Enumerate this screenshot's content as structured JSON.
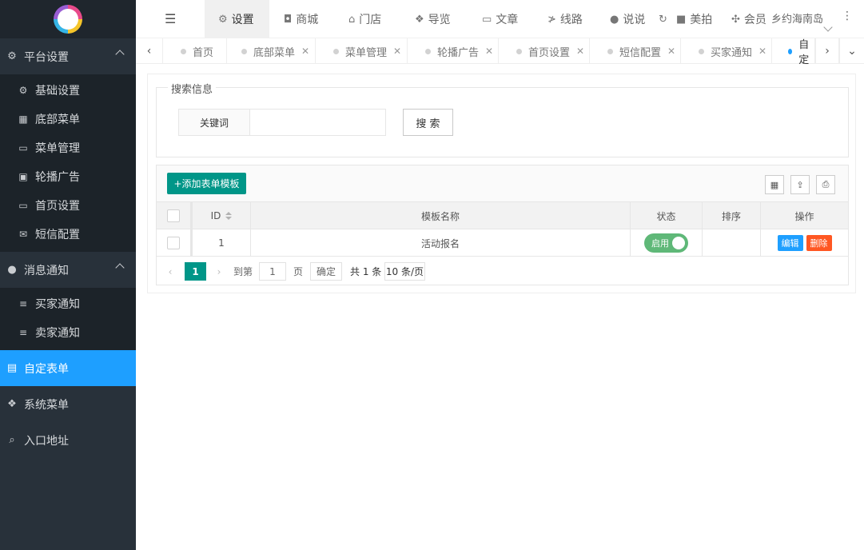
{
  "sidebar": {
    "groups": [
      {
        "label": "平台设置",
        "items": [
          "基础设置",
          "底部菜单",
          "菜单管理",
          "轮播广告",
          "首页设置",
          "短信配置"
        ]
      },
      {
        "label": "消息通知",
        "items": [
          "买家通知",
          "卖家通知"
        ]
      }
    ],
    "active": "自定表单",
    "extra": [
      "系统菜单",
      "入口地址"
    ]
  },
  "topbar": {
    "items": [
      "设置",
      "商城",
      "门店",
      "导览",
      "文章",
      "线路",
      "说说",
      "美拍",
      "会员"
    ],
    "user": "乡约海南岛"
  },
  "tabs": [
    "首页",
    "底部菜单",
    "菜单管理",
    "轮播广告",
    "首页设置",
    "短信配置",
    "买家通知",
    "自定"
  ],
  "search": {
    "legend": "搜索信息",
    "keyword_label": "关键词",
    "keyword_value": "",
    "button": "搜 索"
  },
  "table": {
    "add_button": "+添加表单模板",
    "headers": [
      "ID",
      "模板名称",
      "状态",
      "排序",
      "操作"
    ],
    "rows": [
      {
        "id": "1",
        "name": "活动报名",
        "status": "启用",
        "sort": "",
        "edit": "编辑",
        "delete": "删除"
      }
    ]
  },
  "pager": {
    "current": "1",
    "goto_label": "到第",
    "goto_value": "1",
    "page_label": "页",
    "confirm": "确定",
    "total": "共 1 条",
    "per_page": "10 条/页"
  },
  "colors": {
    "primary": "#009688",
    "active_nav": "#1e9fff",
    "switch_on": "#5fb878",
    "edit": "#1e9fff",
    "delete": "#ff5722"
  }
}
